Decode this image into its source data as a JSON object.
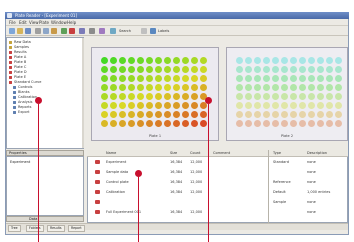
{
  "window": {
    "title": "Plate Reader - [Experiment 01]",
    "accent": "#4a6aa8"
  },
  "menu": [
    "File",
    "Edit",
    "View",
    "Plate",
    "Window",
    "Help"
  ],
  "toolbar": {
    "search_label": "Search",
    "list_label": "Labels"
  },
  "tree": {
    "items": [
      {
        "label": "Raw Data",
        "color": "#c4a23a"
      },
      {
        "label": "Samples",
        "color": "#c4a23a"
      },
      {
        "label": "Results",
        "color": "#c84040"
      },
      {
        "label": "Plate A",
        "color": "#c84040"
      },
      {
        "label": "Plate B",
        "color": "#c84040"
      },
      {
        "label": "Plate C",
        "color": "#c84040"
      },
      {
        "label": "Plate D",
        "color": "#c84040"
      },
      {
        "label": "Plate E",
        "color": "#c84040"
      },
      {
        "label": "Standard Curve",
        "color": "#c84040"
      },
      {
        "label": "Controls",
        "color": "#5f7fb0"
      },
      {
        "label": "Blanks",
        "color": "#5f7fb0"
      },
      {
        "label": "Calibration",
        "color": "#5f7fb0"
      },
      {
        "label": "Analysis",
        "color": "#5f7fb0"
      },
      {
        "label": "Reports",
        "color": "#5f7fb0"
      },
      {
        "label": "Export",
        "color": "#5f7fb0"
      }
    ]
  },
  "bottom_left": {
    "header": "Properties",
    "row1": "Experiment",
    "footer": "Data"
  },
  "plates": [
    {
      "caption": "Plate 1"
    },
    {
      "caption": "Plate 2"
    }
  ],
  "table": {
    "headers": [
      "Name",
      "Size",
      "Count",
      "Comment",
      "Type",
      "Description"
    ],
    "rows": [
      {
        "name": "Experiment",
        "size": "16,384",
        "count": "12,000",
        "type": "Standard",
        "desc": "none"
      },
      {
        "name": "Sample data",
        "size": "16,384",
        "count": "12,000",
        "type": "",
        "desc": "none"
      },
      {
        "name": "Control plate",
        "size": "16,384",
        "count": "12,000",
        "type": "Reference",
        "desc": "none"
      },
      {
        "name": "Calibration",
        "size": "16,384",
        "count": "12,000",
        "type": "Default",
        "desc": "1,000 entries"
      },
      {
        "name": "",
        "size": "",
        "count": "",
        "type": "Sample",
        "desc": "none"
      },
      {
        "name": "Full Experiment 001",
        "size": "16,384",
        "count": "12,000",
        "type": "",
        "desc": "none"
      }
    ]
  },
  "status_tabs": [
    "Tree",
    "Folders",
    "Results",
    "Report"
  ],
  "colors": {
    "callout": "#c8102e"
  }
}
